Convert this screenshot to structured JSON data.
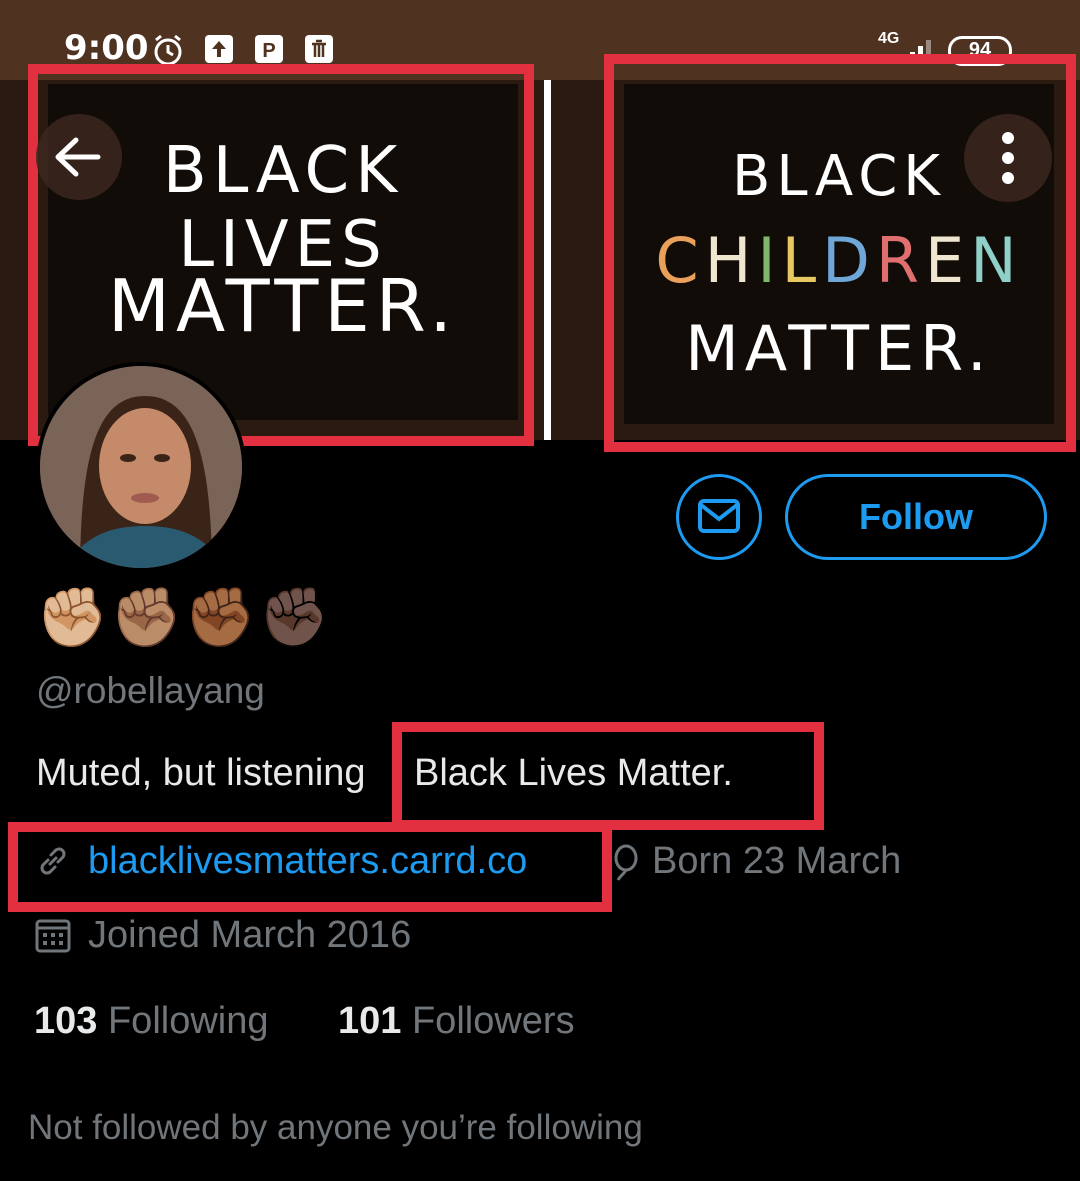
{
  "status_bar": {
    "time": "9:00",
    "network": "4G",
    "battery": "94",
    "icons": [
      "alarm-icon",
      "upload-icon",
      "parking-icon",
      "trash-icon",
      "signal-icon"
    ]
  },
  "banner": {
    "left_text": [
      "BLACK LIVES",
      "MATTER."
    ],
    "right_text": [
      "BLACK",
      "CHILDREN",
      "MATTER."
    ],
    "children_letters": [
      {
        "ch": "C",
        "color": "#e8a05a"
      },
      {
        "ch": "H",
        "color": "#f0e6d0"
      },
      {
        "ch": "I",
        "color": "#7fb86a"
      },
      {
        "ch": "L",
        "color": "#e8c860"
      },
      {
        "ch": "D",
        "color": "#6fa8d8"
      },
      {
        "ch": "R",
        "color": "#e07070"
      },
      {
        "ch": "E",
        "color": "#f0e6d0"
      },
      {
        "ch": "N",
        "color": "#8fd0c8"
      }
    ]
  },
  "profile": {
    "emoji": "✊🏼✊🏽✊🏾✊🏿",
    "handle": "@robellayang",
    "bio_part1": "Muted, but listening",
    "bio_part2": "Black Lives Matter.",
    "link": "blacklivesmatters.carrd.co",
    "born": "Born 23 March",
    "joined": "Joined March 2016",
    "following_count": "103",
    "following_label": "Following",
    "followers_count": "101",
    "followers_label": "Followers",
    "followed_by": "Not followed by anyone you’re following"
  },
  "actions": {
    "follow_label": "Follow"
  },
  "colors": {
    "accent": "#1d9bf0",
    "highlight_box": "#e33040",
    "muted_text": "#71767b"
  }
}
